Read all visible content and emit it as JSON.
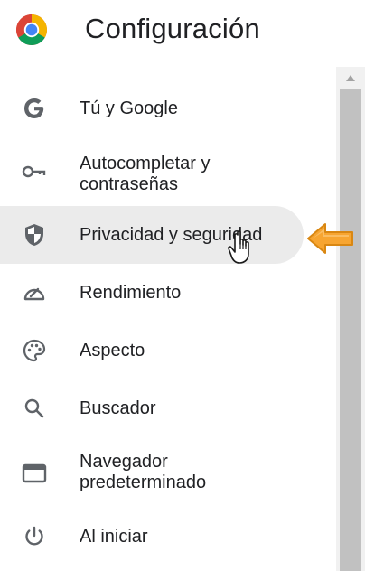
{
  "header": {
    "title": "Configuración",
    "logo_icon": "chrome-logo-icon"
  },
  "sidebar": {
    "items": [
      {
        "label": "Tú y Google",
        "icon": "google-g-icon"
      },
      {
        "label": "Autocompletar y contraseñas",
        "label_line1": "Autocompletar y",
        "label_line2": "contraseñas",
        "icon": "key-icon"
      },
      {
        "label": "Privacidad y seguridad",
        "icon": "shield-icon",
        "selected": true
      },
      {
        "label": "Rendimiento",
        "icon": "speedometer-icon"
      },
      {
        "label": "Aspecto",
        "icon": "palette-icon"
      },
      {
        "label": "Buscador",
        "icon": "search-icon"
      },
      {
        "label": "Navegador predeterminado",
        "label_line1": "Navegador",
        "label_line2": "predeterminado",
        "icon": "browser-window-icon"
      },
      {
        "label": "Al iniciar",
        "icon": "power-icon"
      }
    ]
  },
  "colors": {
    "selected_bg": "#ebebeb",
    "text": "#202124",
    "icon": "#5f6368",
    "arrow": "#f5a623",
    "scroll_thumb": "#c1c1c1",
    "scroll_track": "#f1f1f1"
  },
  "annotations": {
    "pointer_arrow": "orange-arrow-icon",
    "cursor": "hand-cursor-icon"
  }
}
